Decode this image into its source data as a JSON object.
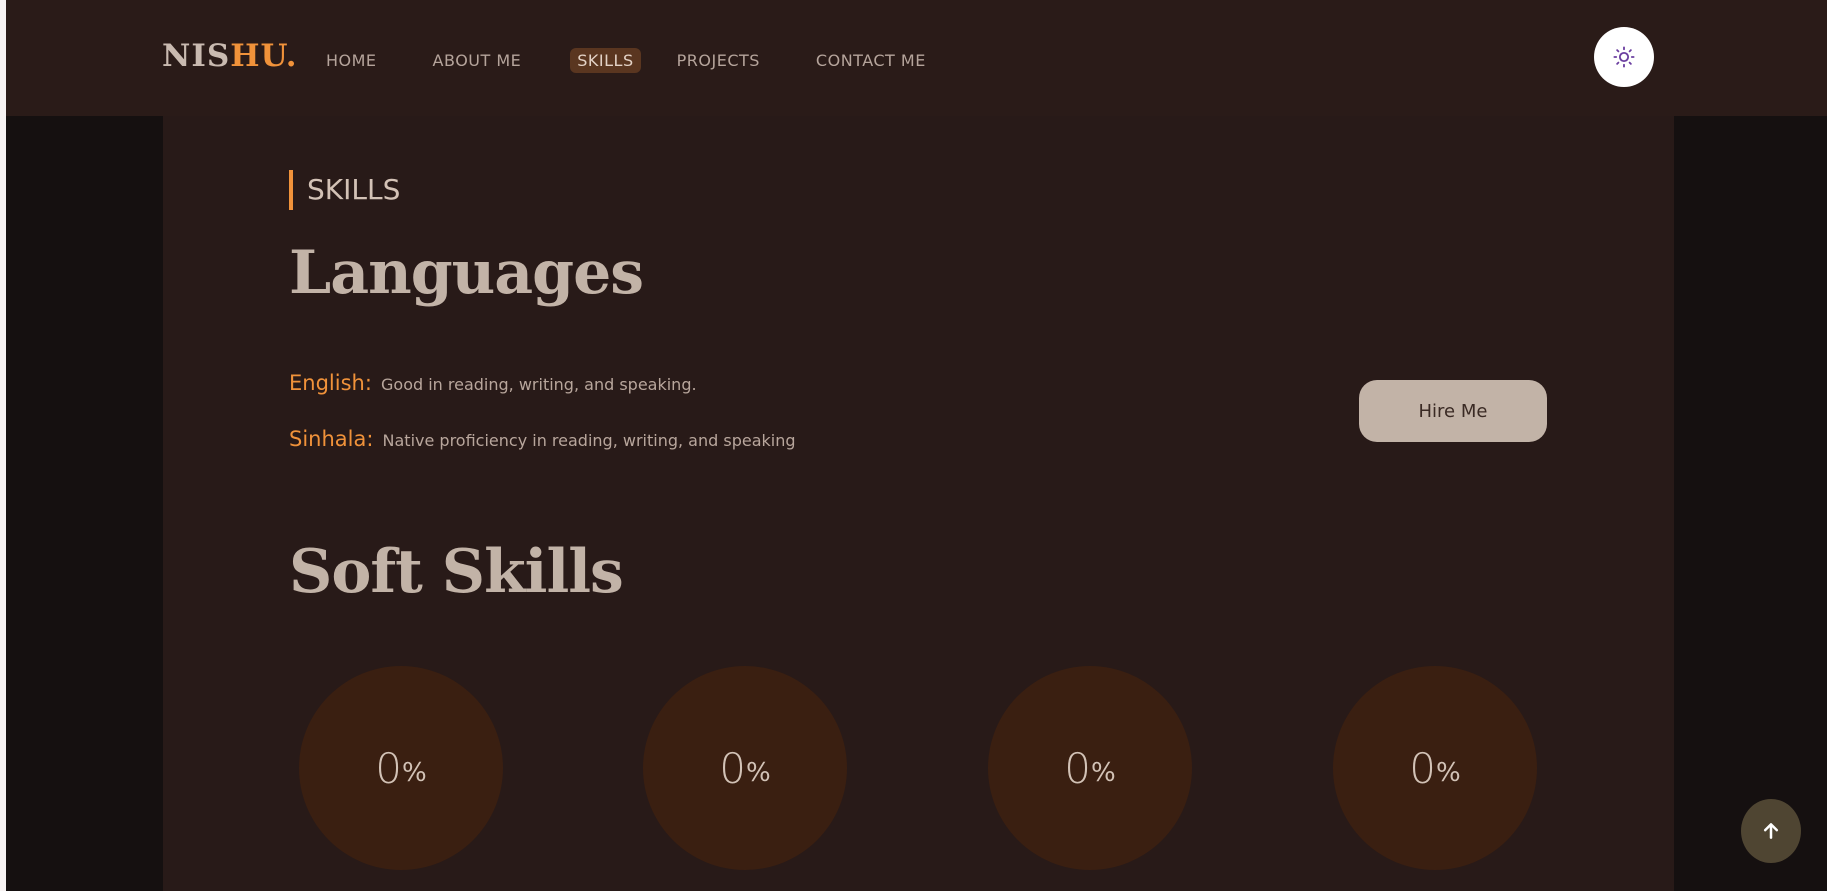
{
  "logo": {
    "part1": "NIS",
    "part2": "HU."
  },
  "nav": {
    "items": [
      {
        "label": "HOME"
      },
      {
        "label": "ABOUT ME"
      },
      {
        "label": "SKILLS"
      },
      {
        "label": "PROJECTS"
      },
      {
        "label": "CONTACT ME"
      }
    ],
    "active": "SKILLS"
  },
  "theme_toggle": {
    "icon": "sun-icon"
  },
  "section": {
    "tag": "SKILLS"
  },
  "languages": {
    "heading": "Languages",
    "items": [
      {
        "name": "English:",
        "description": "Good in reading, writing, and speaking."
      },
      {
        "name": "Sinhala:",
        "description": "Native proficiency in reading, writing, and speaking"
      }
    ]
  },
  "hire_button": {
    "label": "Hire Me"
  },
  "soft_skills": {
    "heading": "Soft Skills",
    "circles": [
      {
        "value": "0",
        "unit": "%"
      },
      {
        "value": "0",
        "unit": "%"
      },
      {
        "value": "0",
        "unit": "%"
      },
      {
        "value": "0",
        "unit": "%"
      }
    ]
  },
  "scroll_top": {
    "icon": "arrow-up-icon"
  },
  "colors": {
    "accent": "#f0923a",
    "navbar": "#2a1b18",
    "content_bg": "#281a18",
    "circle_bg": "#3a1f11",
    "button_bg": "#c2b3a7"
  }
}
